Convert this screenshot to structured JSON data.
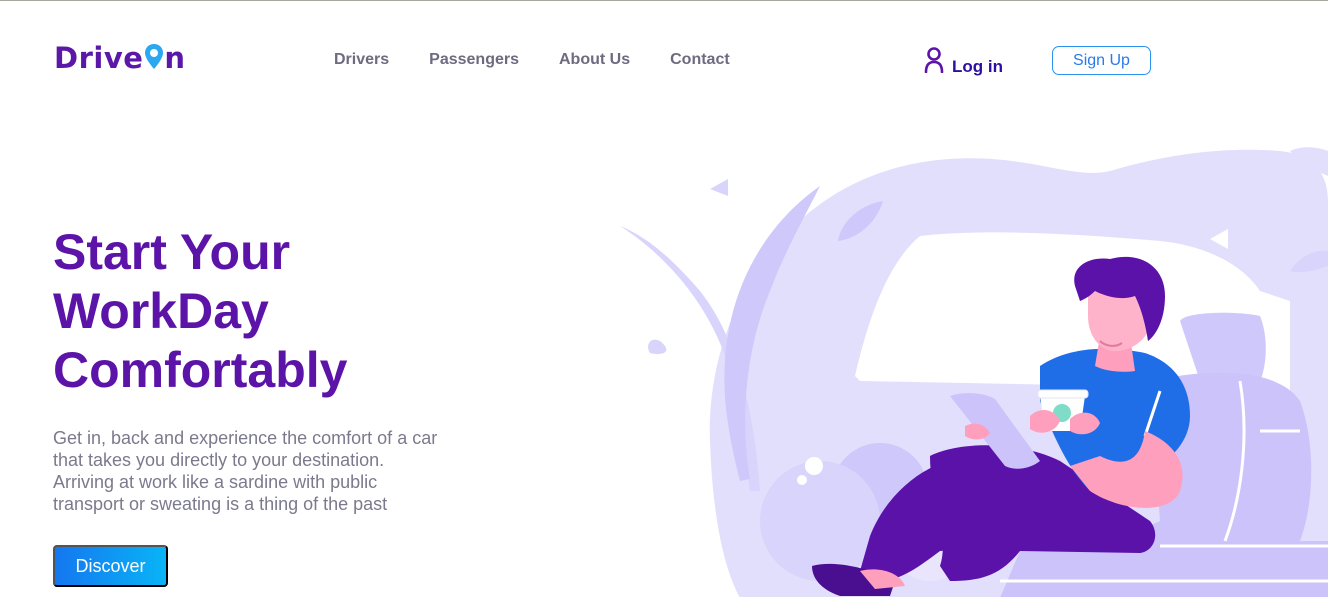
{
  "brand": {
    "logo_text_left": "Drive",
    "logo_text_right": "n",
    "logo_icon": "map-pin-icon",
    "primary_color": "#5c13a8",
    "accent_color": "#2aa8f0"
  },
  "nav": {
    "items": [
      {
        "label": "Drivers"
      },
      {
        "label": "Passengers"
      },
      {
        "label": "About Us"
      },
      {
        "label": "Contact"
      }
    ]
  },
  "auth": {
    "login_label": "Log in",
    "login_icon": "user-icon",
    "signup_label": "Sign Up"
  },
  "hero": {
    "headline_lines": [
      "Start Your",
      "WorkDay",
      "Comfortably"
    ],
    "description_lines": [
      "Get in, back and experience the comfort of a car",
      "that takes you directly to your destination.",
      "Arriving at work like a sardine with public",
      "transport or sweating is a thing of the past"
    ],
    "cta_label": "Discover",
    "illustration": "man-relaxing-in-car-illustration"
  }
}
